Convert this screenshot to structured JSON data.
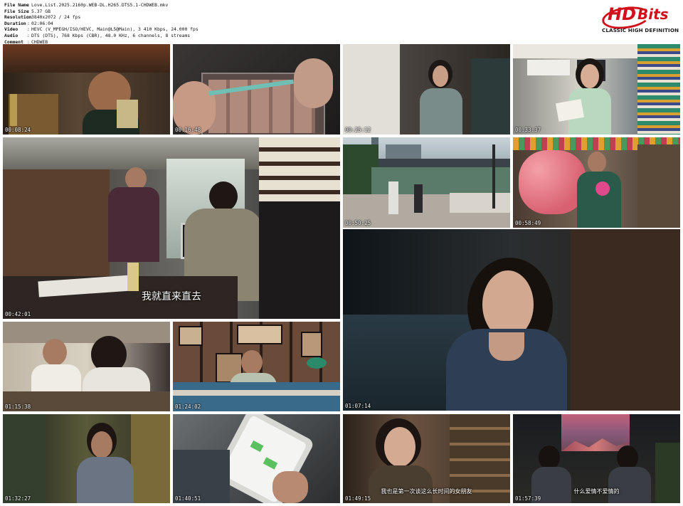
{
  "info": [
    {
      "key": "File Name",
      "value": "Love.List.2025.2160p.WEB-DL.H265.DTS5.1-CHDWEB.mkv"
    },
    {
      "key": "File Size",
      "value": "5.37 GB"
    },
    {
      "key": "Resolution",
      "value": "3840x2072 / 24 fps"
    },
    {
      "key": "Duration",
      "value": "02:06:04"
    },
    {
      "key": "Video",
      "value": "HEVC (V_MPEGH/ISO/HEVC, Main@L5@Main), 3 410 Kbps, 24.000 fps"
    },
    {
      "key": "Audio",
      "value": "DTS (DTS), 768 Kbps (CBR), 48.0 KHz, 6 channels, 8 streams"
    },
    {
      "key": "Comment",
      "value": "CHDWEB"
    }
  ],
  "logo": {
    "hd": "HD",
    "bits": "Bits",
    "tagline": "CLASSIC HIGH DEFINITION",
    "color": "#d0101a"
  },
  "frames": [
    {
      "time": "00:08:24",
      "subtitle": ""
    },
    {
      "time": "00:16:48",
      "subtitle": ""
    },
    {
      "time": "00:25:12",
      "subtitle": ""
    },
    {
      "time": "00:33:37",
      "subtitle": ""
    },
    {
      "time": "00:42:01",
      "subtitle": "我就直来直去"
    },
    {
      "time": "00:50:25",
      "subtitle": ""
    },
    {
      "time": "00:58:49",
      "subtitle": ""
    },
    {
      "time": "01:07:14",
      "subtitle": ""
    },
    {
      "time": "01:15:38",
      "subtitle": ""
    },
    {
      "time": "01:24:02",
      "subtitle": ""
    },
    {
      "time": "01:32:27",
      "subtitle": ""
    },
    {
      "time": "01:40:51",
      "subtitle": ""
    },
    {
      "time": "01:49:15",
      "subtitle": "我也是第一次谈这么长时间的女朋友"
    },
    {
      "time": "01:57:39",
      "subtitle": "什么爱情不爱情的"
    }
  ]
}
